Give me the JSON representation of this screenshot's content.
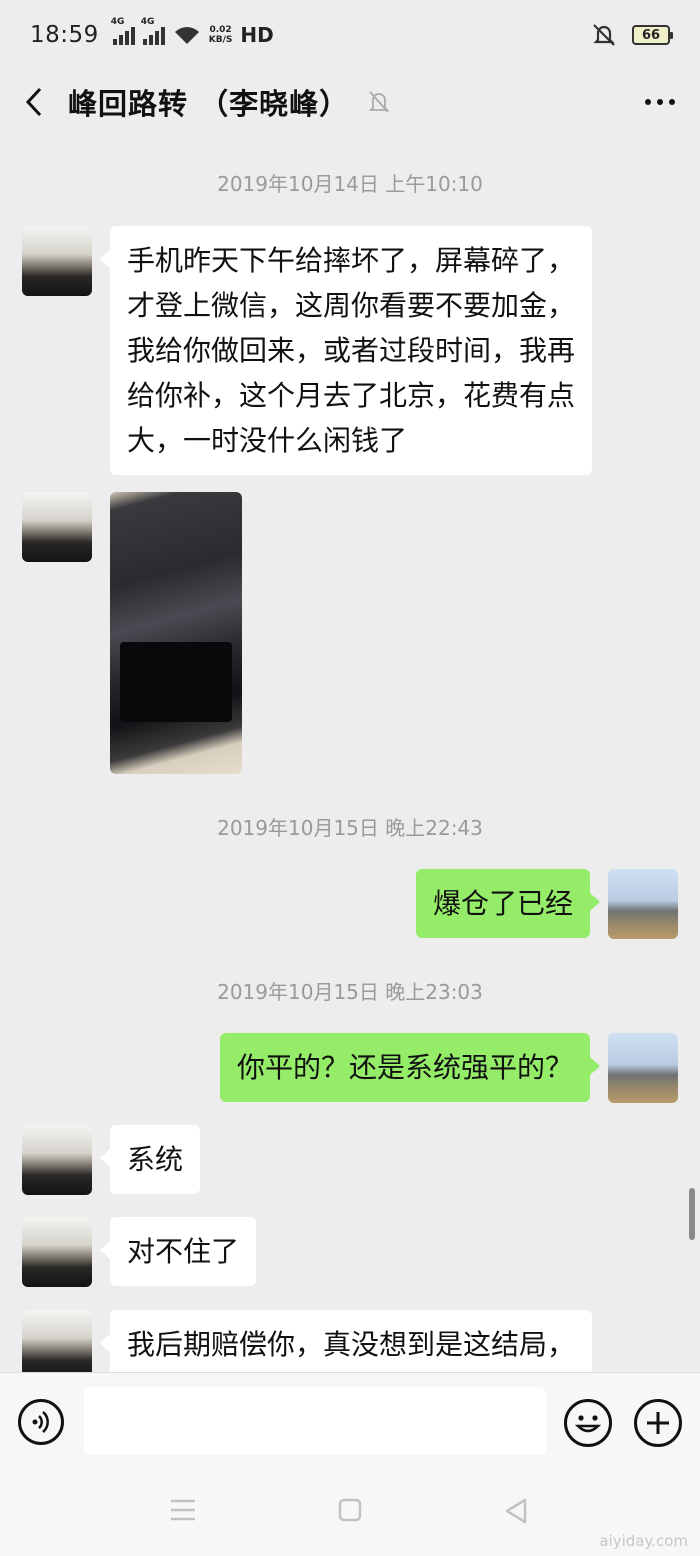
{
  "status_bar": {
    "time": "18:59",
    "signal1_tag": "4G",
    "signal2_tag": "4G",
    "net_speed_value": "0.02",
    "net_speed_unit": "KB/S",
    "hd_label": "HD",
    "battery": "66"
  },
  "nav": {
    "title": "峰回路转 （李晓峰）"
  },
  "chat": {
    "timestamps": [
      "2019年10月14日 上午10:10",
      "2019年10月15日 晚上22:43",
      "2019年10月15日 晚上23:03"
    ],
    "messages": [
      {
        "from": "other",
        "type": "text",
        "text": "手机昨天下午给摔坏了，屏幕碎了，才登上微信，这周你看要不要加金，我给你做回来，或者过段时间，我再给你补，这个月去了北京，花费有点大，一时没什么闲钱了"
      },
      {
        "from": "other",
        "type": "image"
      },
      {
        "from": "me",
        "type": "text",
        "text": "爆仓了已经"
      },
      {
        "from": "me",
        "type": "text",
        "text": "你平的？还是系统强平的？"
      },
      {
        "from": "other",
        "type": "text",
        "text": "系统"
      },
      {
        "from": "other",
        "type": "text",
        "text": "对不住了"
      },
      {
        "from": "other",
        "type": "text",
        "text": "我后期赔偿你，真没想到是这结局，"
      }
    ]
  },
  "input": {
    "placeholder": ""
  },
  "icons": {
    "back": "chevron-left-icon",
    "mute": "bell-off-icon",
    "more": "more-dots-icon",
    "voice": "voice-icon",
    "emoji": "emoji-icon",
    "plus": "plus-icon",
    "sys_menu": "menu-icon",
    "sys_home": "home-icon",
    "sys_back": "back-triangle-icon"
  },
  "colors": {
    "background": "#ededed",
    "bubble_in": "#ffffff",
    "bubble_out": "#95ec69",
    "timestamp": "#9a9a9a"
  },
  "watermark": "aiyiday.com"
}
